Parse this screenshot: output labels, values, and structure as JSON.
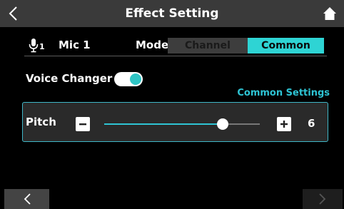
{
  "header": {
    "title": "Effect Setting",
    "back_icon": "chevron-left-icon",
    "home_icon": "home-icon"
  },
  "mic": {
    "icon": "microphone-icon",
    "number": "1",
    "name": "Mic 1"
  },
  "mode": {
    "label": "Mode",
    "options": [
      "Channel",
      "Common"
    ],
    "selected": "Common"
  },
  "voice_changer": {
    "label": "Voice Changer",
    "enabled": true
  },
  "section_title": "Common Settings",
  "pitch": {
    "label": "Pitch",
    "value": "6",
    "slider_fraction": 0.76,
    "minus_icon": "minus-icon",
    "plus_icon": "plus-icon"
  },
  "nav": {
    "prev_icon": "chevron-left-icon",
    "next_icon": "chevron-right-icon",
    "next_enabled": false
  },
  "colors": {
    "accent": "#2ed4d4",
    "header_bg": "#3a3a3a",
    "panel_border": "#3fb8c8"
  }
}
